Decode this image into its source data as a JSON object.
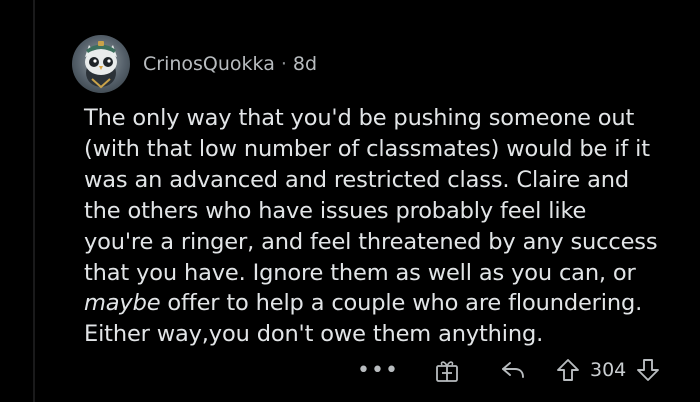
{
  "comment": {
    "username": "CrinosQuokka",
    "separator": "·",
    "age": "8d",
    "body_lines": [
      "The only way that you'd be pushing someone out",
      "(with that low number of classmates) would be if it",
      "was an advanced and restricted class. Claire and",
      "the others who have issues probably feel like",
      "you're a ringer, and feel threatened by any success",
      "that you have. Ignore them as well as you can, or"
    ],
    "emphasis_word": "maybe",
    "line7_rest": " offer to help a couple who are floundering.",
    "line8": "Either way,you don't owe them anything."
  },
  "actions": {
    "more_label": "•••",
    "score": "304",
    "icons": [
      "more-options-icon",
      "give-award-icon",
      "reply-icon",
      "upvote-icon",
      "downvote-icon"
    ]
  },
  "colors": {
    "background": "#000000",
    "text": "#e2e5e7",
    "meta": "#b8bcbf"
  }
}
